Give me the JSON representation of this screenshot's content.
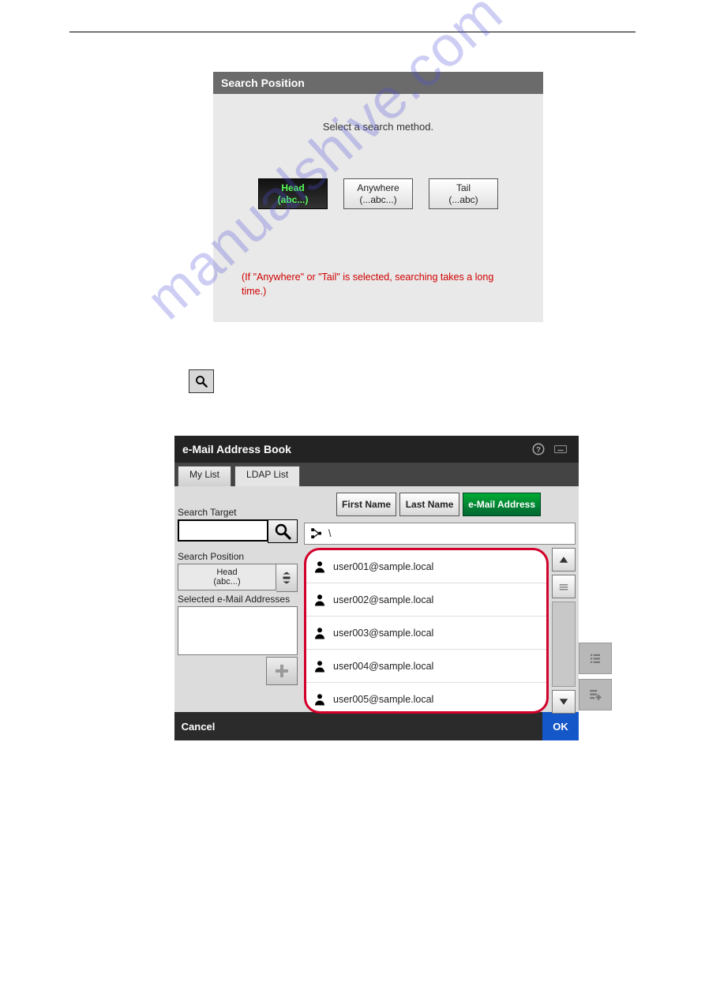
{
  "watermark": "manualshive.com",
  "panel1": {
    "title": "Search Position",
    "instruction": "Select a search method.",
    "methods": [
      {
        "label": "Head",
        "hint": "(abc...)",
        "active": true
      },
      {
        "label": "Anywhere",
        "hint": "(...abc...)",
        "active": false
      },
      {
        "label": "Tail",
        "hint": "(...abc)",
        "active": false
      }
    ],
    "note": "(If \"Anywhere\" or \"Tail\" is selected, searching takes a long time.)"
  },
  "panel2": {
    "title": "e-Mail Address Book",
    "tabs": [
      {
        "label": "My List",
        "active": false
      },
      {
        "label": "LDAP List",
        "active": true
      }
    ],
    "modes": [
      {
        "label": "First Name",
        "active": false
      },
      {
        "label": "Last Name",
        "active": false
      },
      {
        "label": "e-Mail Address",
        "active": true
      }
    ],
    "search_target_label": "Search Target",
    "search_target_value": "",
    "search_position_label": "Search Position",
    "search_position_value": {
      "line1": "Head",
      "line2": "(abc...)"
    },
    "selected_label": "Selected e-Mail Addresses",
    "path_display": "\\",
    "results": [
      "user001@sample.local",
      "user002@sample.local",
      "user003@sample.local",
      "user004@sample.local",
      "user005@sample.local"
    ],
    "cancel_label": "Cancel",
    "ok_label": "OK"
  }
}
